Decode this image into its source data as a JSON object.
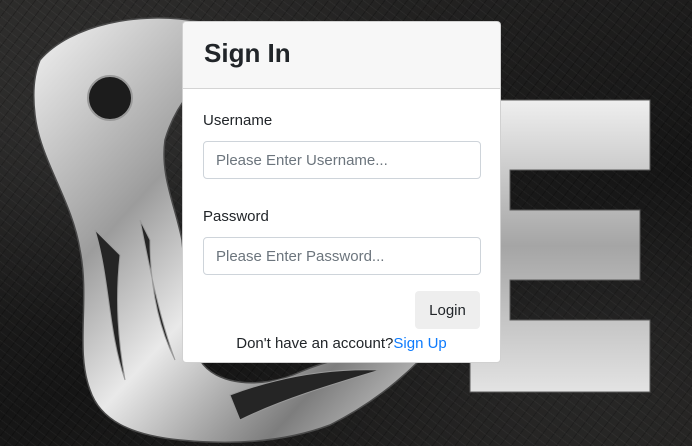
{
  "page": {
    "background": "dark-leather-texture",
    "logo": "silver-metallic-emblem-logo"
  },
  "signin": {
    "title": "Sign In",
    "username_label": "Username",
    "username_placeholder": "Please Enter Username...",
    "username_value": "",
    "password_label": "Password",
    "password_placeholder": "Please Enter Password...",
    "password_value": "",
    "login_label": "Login",
    "signup_prompt": "Don't have an account?",
    "signup_link": "Sign Up"
  },
  "colors": {
    "link": "#0d7bfd",
    "card_header": "#f7f7f7",
    "button": "#eeeeee"
  }
}
